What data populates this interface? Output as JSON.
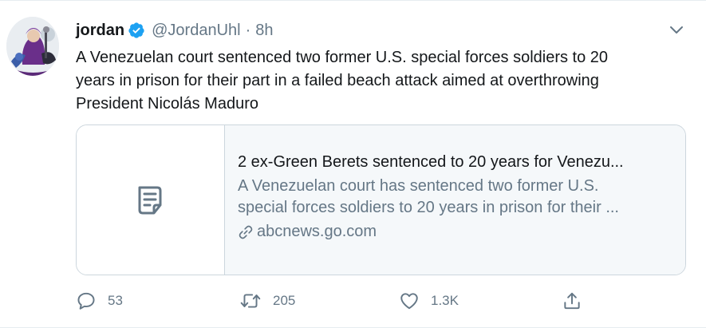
{
  "tweet": {
    "author_name": "jordan",
    "handle": "@JordanUhl",
    "separator": "·",
    "time": "8h",
    "text_lines": [
      "A Venezuelan court sentenced two former U.S. special forces soldiers to 20",
      "years in prison for their part in a failed beach attack aimed at overthrowing",
      "President Nicolás Maduro"
    ]
  },
  "card": {
    "title": "2 ex-Green Berets sentenced to 20 years for Venezu...",
    "description_lines": [
      "A Venezuelan court has sentenced two former U.S.",
      "special forces soldiers to 20 years in prison for their ..."
    ],
    "domain": "abcnews.go.com",
    "thumb_icon": "document-icon"
  },
  "actions": {
    "reply_count": "53",
    "retweet_count": "205",
    "like_count": "1.3K"
  },
  "colors": {
    "verified": "#1da1f2",
    "text": "#14171a",
    "secondary": "#657786",
    "border": "#ccd6dd",
    "card_bg": "#f5f8fa"
  },
  "icons": [
    "verified-badge-icon",
    "chevron-down-icon",
    "link-icon",
    "reply-icon",
    "retweet-icon",
    "like-icon",
    "share-icon"
  ]
}
